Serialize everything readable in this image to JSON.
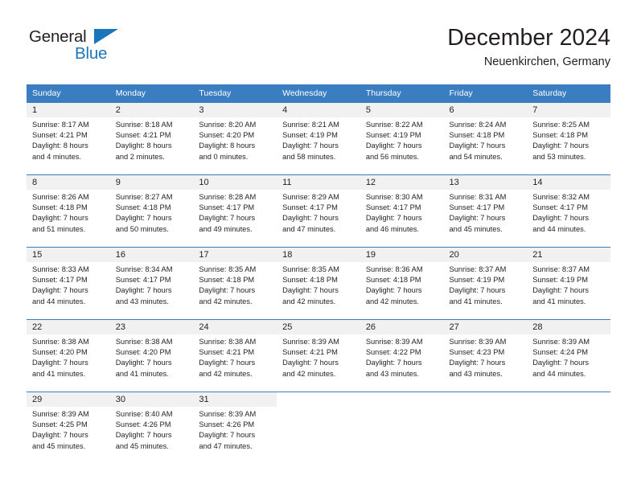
{
  "brand": {
    "name_part1": "General",
    "name_part2": "Blue",
    "triangle_color": "#1b75bb",
    "text_color": "#231f20"
  },
  "header": {
    "title": "December 2024",
    "subtitle": "Neuenkirchen, Germany"
  },
  "theme": {
    "header_bg": "#3b7dc1",
    "header_text": "#ffffff",
    "daynum_bg": "#f1f1f1",
    "body_text": "#231f20",
    "cell_bg": "#ffffff"
  },
  "weekday_headers": [
    "Sunday",
    "Monday",
    "Tuesday",
    "Wednesday",
    "Thursday",
    "Friday",
    "Saturday"
  ],
  "weeks": [
    [
      {
        "day": "1",
        "sunrise": "Sunrise: 8:17 AM",
        "sunset": "Sunset: 4:21 PM",
        "daylight_line1": "Daylight: 8 hours",
        "daylight_line2": "and 4 minutes."
      },
      {
        "day": "2",
        "sunrise": "Sunrise: 8:18 AM",
        "sunset": "Sunset: 4:21 PM",
        "daylight_line1": "Daylight: 8 hours",
        "daylight_line2": "and 2 minutes."
      },
      {
        "day": "3",
        "sunrise": "Sunrise: 8:20 AM",
        "sunset": "Sunset: 4:20 PM",
        "daylight_line1": "Daylight: 8 hours",
        "daylight_line2": "and 0 minutes."
      },
      {
        "day": "4",
        "sunrise": "Sunrise: 8:21 AM",
        "sunset": "Sunset: 4:19 PM",
        "daylight_line1": "Daylight: 7 hours",
        "daylight_line2": "and 58 minutes."
      },
      {
        "day": "5",
        "sunrise": "Sunrise: 8:22 AM",
        "sunset": "Sunset: 4:19 PM",
        "daylight_line1": "Daylight: 7 hours",
        "daylight_line2": "and 56 minutes."
      },
      {
        "day": "6",
        "sunrise": "Sunrise: 8:24 AM",
        "sunset": "Sunset: 4:18 PM",
        "daylight_line1": "Daylight: 7 hours",
        "daylight_line2": "and 54 minutes."
      },
      {
        "day": "7",
        "sunrise": "Sunrise: 8:25 AM",
        "sunset": "Sunset: 4:18 PM",
        "daylight_line1": "Daylight: 7 hours",
        "daylight_line2": "and 53 minutes."
      }
    ],
    [
      {
        "day": "8",
        "sunrise": "Sunrise: 8:26 AM",
        "sunset": "Sunset: 4:18 PM",
        "daylight_line1": "Daylight: 7 hours",
        "daylight_line2": "and 51 minutes."
      },
      {
        "day": "9",
        "sunrise": "Sunrise: 8:27 AM",
        "sunset": "Sunset: 4:18 PM",
        "daylight_line1": "Daylight: 7 hours",
        "daylight_line2": "and 50 minutes."
      },
      {
        "day": "10",
        "sunrise": "Sunrise: 8:28 AM",
        "sunset": "Sunset: 4:17 PM",
        "daylight_line1": "Daylight: 7 hours",
        "daylight_line2": "and 49 minutes."
      },
      {
        "day": "11",
        "sunrise": "Sunrise: 8:29 AM",
        "sunset": "Sunset: 4:17 PM",
        "daylight_line1": "Daylight: 7 hours",
        "daylight_line2": "and 47 minutes."
      },
      {
        "day": "12",
        "sunrise": "Sunrise: 8:30 AM",
        "sunset": "Sunset: 4:17 PM",
        "daylight_line1": "Daylight: 7 hours",
        "daylight_line2": "and 46 minutes."
      },
      {
        "day": "13",
        "sunrise": "Sunrise: 8:31 AM",
        "sunset": "Sunset: 4:17 PM",
        "daylight_line1": "Daylight: 7 hours",
        "daylight_line2": "and 45 minutes."
      },
      {
        "day": "14",
        "sunrise": "Sunrise: 8:32 AM",
        "sunset": "Sunset: 4:17 PM",
        "daylight_line1": "Daylight: 7 hours",
        "daylight_line2": "and 44 minutes."
      }
    ],
    [
      {
        "day": "15",
        "sunrise": "Sunrise: 8:33 AM",
        "sunset": "Sunset: 4:17 PM",
        "daylight_line1": "Daylight: 7 hours",
        "daylight_line2": "and 44 minutes."
      },
      {
        "day": "16",
        "sunrise": "Sunrise: 8:34 AM",
        "sunset": "Sunset: 4:17 PM",
        "daylight_line1": "Daylight: 7 hours",
        "daylight_line2": "and 43 minutes."
      },
      {
        "day": "17",
        "sunrise": "Sunrise: 8:35 AM",
        "sunset": "Sunset: 4:18 PM",
        "daylight_line1": "Daylight: 7 hours",
        "daylight_line2": "and 42 minutes."
      },
      {
        "day": "18",
        "sunrise": "Sunrise: 8:35 AM",
        "sunset": "Sunset: 4:18 PM",
        "daylight_line1": "Daylight: 7 hours",
        "daylight_line2": "and 42 minutes."
      },
      {
        "day": "19",
        "sunrise": "Sunrise: 8:36 AM",
        "sunset": "Sunset: 4:18 PM",
        "daylight_line1": "Daylight: 7 hours",
        "daylight_line2": "and 42 minutes."
      },
      {
        "day": "20",
        "sunrise": "Sunrise: 8:37 AM",
        "sunset": "Sunset: 4:19 PM",
        "daylight_line1": "Daylight: 7 hours",
        "daylight_line2": "and 41 minutes."
      },
      {
        "day": "21",
        "sunrise": "Sunrise: 8:37 AM",
        "sunset": "Sunset: 4:19 PM",
        "daylight_line1": "Daylight: 7 hours",
        "daylight_line2": "and 41 minutes."
      }
    ],
    [
      {
        "day": "22",
        "sunrise": "Sunrise: 8:38 AM",
        "sunset": "Sunset: 4:20 PM",
        "daylight_line1": "Daylight: 7 hours",
        "daylight_line2": "and 41 minutes."
      },
      {
        "day": "23",
        "sunrise": "Sunrise: 8:38 AM",
        "sunset": "Sunset: 4:20 PM",
        "daylight_line1": "Daylight: 7 hours",
        "daylight_line2": "and 41 minutes."
      },
      {
        "day": "24",
        "sunrise": "Sunrise: 8:38 AM",
        "sunset": "Sunset: 4:21 PM",
        "daylight_line1": "Daylight: 7 hours",
        "daylight_line2": "and 42 minutes."
      },
      {
        "day": "25",
        "sunrise": "Sunrise: 8:39 AM",
        "sunset": "Sunset: 4:21 PM",
        "daylight_line1": "Daylight: 7 hours",
        "daylight_line2": "and 42 minutes."
      },
      {
        "day": "26",
        "sunrise": "Sunrise: 8:39 AM",
        "sunset": "Sunset: 4:22 PM",
        "daylight_line1": "Daylight: 7 hours",
        "daylight_line2": "and 43 minutes."
      },
      {
        "day": "27",
        "sunrise": "Sunrise: 8:39 AM",
        "sunset": "Sunset: 4:23 PM",
        "daylight_line1": "Daylight: 7 hours",
        "daylight_line2": "and 43 minutes."
      },
      {
        "day": "28",
        "sunrise": "Sunrise: 8:39 AM",
        "sunset": "Sunset: 4:24 PM",
        "daylight_line1": "Daylight: 7 hours",
        "daylight_line2": "and 44 minutes."
      }
    ],
    [
      {
        "day": "29",
        "sunrise": "Sunrise: 8:39 AM",
        "sunset": "Sunset: 4:25 PM",
        "daylight_line1": "Daylight: 7 hours",
        "daylight_line2": "and 45 minutes."
      },
      {
        "day": "30",
        "sunrise": "Sunrise: 8:40 AM",
        "sunset": "Sunset: 4:26 PM",
        "daylight_line1": "Daylight: 7 hours",
        "daylight_line2": "and 45 minutes."
      },
      {
        "day": "31",
        "sunrise": "Sunrise: 8:39 AM",
        "sunset": "Sunset: 4:26 PM",
        "daylight_line1": "Daylight: 7 hours",
        "daylight_line2": "and 47 minutes."
      },
      {
        "day": "",
        "sunrise": "",
        "sunset": "",
        "daylight_line1": "",
        "daylight_line2": ""
      },
      {
        "day": "",
        "sunrise": "",
        "sunset": "",
        "daylight_line1": "",
        "daylight_line2": ""
      },
      {
        "day": "",
        "sunrise": "",
        "sunset": "",
        "daylight_line1": "",
        "daylight_line2": ""
      },
      {
        "day": "",
        "sunrise": "",
        "sunset": "",
        "daylight_line1": "",
        "daylight_line2": ""
      }
    ]
  ]
}
